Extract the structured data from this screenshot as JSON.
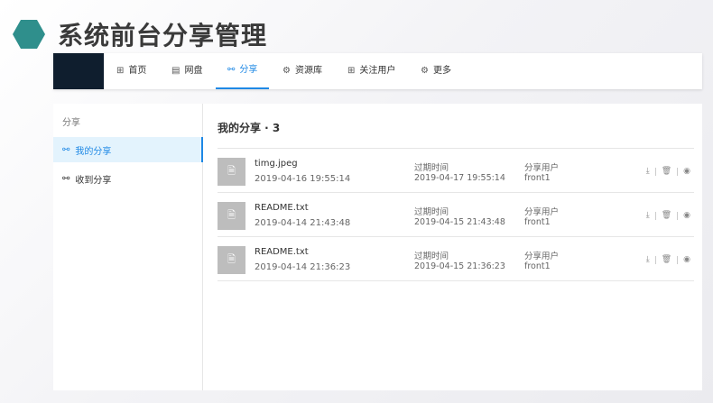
{
  "slide": {
    "title": "系统前台分享管理"
  },
  "nav": {
    "items": [
      {
        "label": "首页",
        "icon": "grid-icon",
        "glyph": "⊞"
      },
      {
        "label": "网盘",
        "icon": "folder-icon",
        "glyph": "▤"
      },
      {
        "label": "分享",
        "icon": "share-icon",
        "glyph": "⚯"
      },
      {
        "label": "资源库",
        "icon": "gear-icon",
        "glyph": "⚙"
      },
      {
        "label": "关注用户",
        "icon": "grid-icon",
        "glyph": "⊞"
      },
      {
        "label": "更多",
        "icon": "gear-icon",
        "glyph": "⚙"
      }
    ],
    "active": "分享"
  },
  "sidebar": {
    "heading": "分享",
    "items": [
      {
        "label": "我的分享",
        "icon": "share-icon",
        "glyph": "⚯"
      },
      {
        "label": "收到分享",
        "icon": "share-icon",
        "glyph": "⚯"
      }
    ]
  },
  "content": {
    "title": "我的分享 · 3",
    "expire_label": "过期时间",
    "user_label": "分享用户",
    "rows": [
      {
        "name": "timg.jpeg",
        "created": "2019-04-16 19:55:14",
        "expire": "2019-04-17 19:55:14",
        "user": "front1"
      },
      {
        "name": "README.txt",
        "created": "2019-04-14 21:43:48",
        "expire": "2019-04-15 21:43:48",
        "user": "front1"
      },
      {
        "name": "README.txt",
        "created": "2019-04-14 21:36:23",
        "expire": "2019-04-15 21:36:23",
        "user": "front1"
      }
    ]
  },
  "icons": {
    "file": "file-icon",
    "download": "download-icon",
    "delete": "trash-icon",
    "view": "eye-icon"
  },
  "colors": {
    "accent": "#1e88e5",
    "hexagon": "#2f8f8c",
    "logo_bg": "#0f1e2e"
  }
}
